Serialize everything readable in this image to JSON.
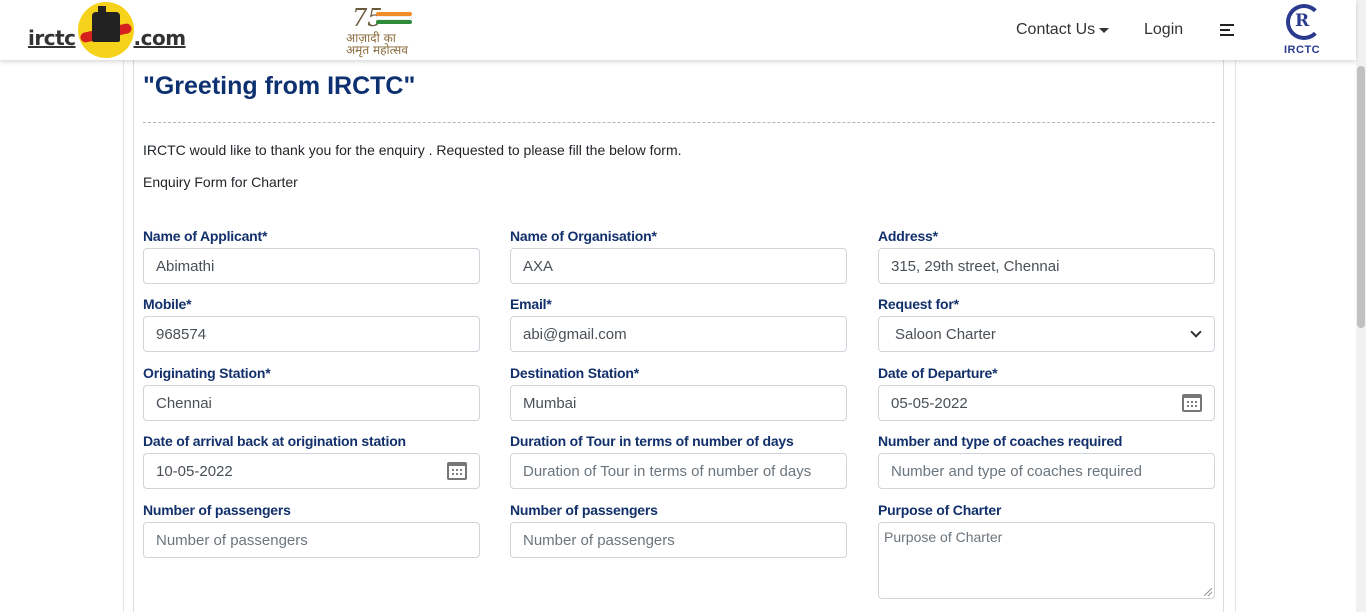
{
  "header": {
    "logo_text_left": "irctc",
    "logo_text_right": ".com",
    "azadi_number": "75",
    "azadi_text_line1": "आज़ादी का",
    "azadi_text_line2": "अमृत महोत्सव",
    "nav_contact": "Contact Us",
    "nav_login": "Login",
    "irctc_emblem_letter": "R",
    "irctc_emblem_label": "IRCTC"
  },
  "main": {
    "greeting": "\"Greeting from IRCTC\"",
    "thanks": "IRCTC would like to thank you for the enquiry . Requested to please fill the below form.",
    "form_caption": "Enquiry Form for Charter"
  },
  "form": {
    "applicant": {
      "label": "Name of Applicant*",
      "value": "Abimathi"
    },
    "organisation": {
      "label": "Name of Organisation*",
      "value": "AXA"
    },
    "address": {
      "label": "Address*",
      "value": "315, 29th street, Chennai"
    },
    "mobile": {
      "label": "Mobile*",
      "value": "968574"
    },
    "email": {
      "label": "Email*",
      "value": "abi@gmail.com"
    },
    "request_for": {
      "label": "Request for*",
      "value": "Saloon Charter"
    },
    "origin": {
      "label": "Originating Station*",
      "value": "Chennai"
    },
    "destination": {
      "label": "Destination Station*",
      "value": "Mumbai"
    },
    "departure": {
      "label": "Date of Departure*",
      "value": "05-05-2022"
    },
    "arrival_back": {
      "label": "Date of arrival back at origination station",
      "value": "10-05-2022"
    },
    "duration": {
      "label": "Duration of Tour in terms of number of days",
      "placeholder": "Duration of Tour in terms of number of days"
    },
    "coaches": {
      "label": "Number and type of coaches required",
      "placeholder": "Number and type of coaches required"
    },
    "passengers_1": {
      "label": "Number of passengers",
      "placeholder": "Number of passengers"
    },
    "passengers_2": {
      "label": "Number of passengers",
      "placeholder": "Number of passengers"
    },
    "purpose": {
      "label": "Purpose of Charter",
      "placeholder": "Purpose of Charter"
    }
  }
}
